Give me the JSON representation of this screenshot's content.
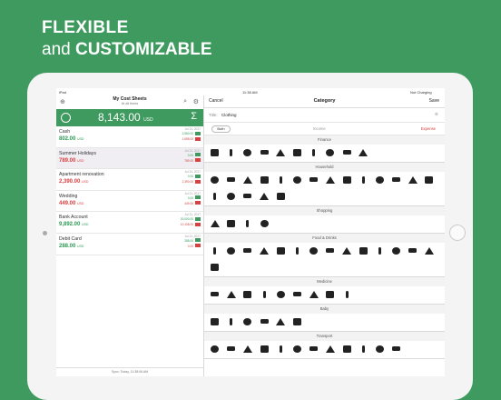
{
  "hero": {
    "line1": "FLEXIBLE",
    "line2_prefix": "and",
    "line2_bold": "CUSTOMIZABLE"
  },
  "status": {
    "carrier": "iPad",
    "time": "11:38 AM",
    "battery": "Not Charging"
  },
  "left": {
    "title": "My Cost Sheets",
    "subtitle": "At all times",
    "balance": "8,143.00",
    "currency": "USD",
    "accounts": [
      {
        "name": "Cash",
        "amount": "802.00",
        "unit": "USD",
        "date": "Jul 21, 2017",
        "income": "2,560.00",
        "expense": "1,658.00"
      },
      {
        "name": "Summer Holidays",
        "amount": "789.00",
        "unit": "USD",
        "date": "Jul 21, 2017",
        "income": "0.00",
        "expense": "789.00"
      },
      {
        "name": "Apartment renovation",
        "amount": "2,390.00",
        "unit": "USD",
        "date": "Jul 21, 2017",
        "income": "0.00",
        "expense": "2,390.00"
      },
      {
        "name": "Wedding",
        "amount": "449.00",
        "unit": "USD",
        "date": "Jul 21, 2017",
        "income": "0.00",
        "expense": "449.00"
      },
      {
        "name": "Bank Account",
        "amount": "9,892.00",
        "unit": "USD",
        "date": "Jul 21, 2017",
        "income": "20,000.00",
        "expense": "10,108.00"
      },
      {
        "name": "Debit Card",
        "amount": "288.00",
        "unit": "USD",
        "date": "Jul 21, 2017",
        "income": "288.00",
        "expense": "0.00"
      }
    ],
    "footer": "Sync: Today, 11:38:06 AM"
  },
  "right": {
    "cancel": "Cancel",
    "heading": "Category",
    "save": "Save",
    "title_label": "Title:",
    "title_value": "Clothing",
    "both": "Both",
    "income": "Income",
    "expense": "Expense",
    "sections": [
      {
        "name": "Finance",
        "count": 10
      },
      {
        "name": "Household",
        "count": 19
      },
      {
        "name": "Shopping",
        "count": 4
      },
      {
        "name": "Food & Drinks",
        "count": 15
      },
      {
        "name": "Medicine",
        "count": 9
      },
      {
        "name": "Baby",
        "count": 6
      },
      {
        "name": "Transport",
        "count": 12
      }
    ]
  },
  "colors": {
    "brand": "#3e9a5e",
    "income": "#3e9a5e",
    "expense": "#d94040"
  }
}
